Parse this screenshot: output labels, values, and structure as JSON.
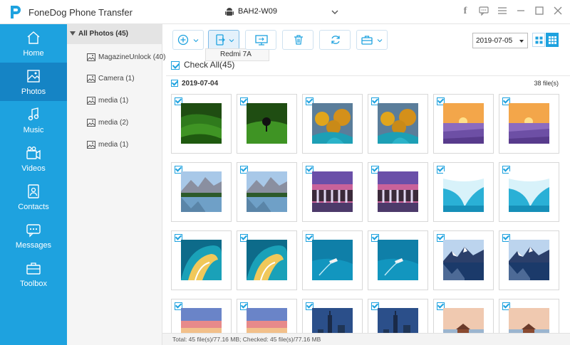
{
  "app": {
    "title": "FoneDog Phone Transfer",
    "device": "BAH2-W09",
    "accent": "#1ea2df"
  },
  "window_controls": [
    "facebook-icon",
    "feedback-icon",
    "menu-icon",
    "minimize-icon",
    "maximize-icon",
    "close-icon"
  ],
  "nav": [
    {
      "label": "Home",
      "icon": "home-icon"
    },
    {
      "label": "Photos",
      "icon": "photos-icon",
      "active": true
    },
    {
      "label": "Music",
      "icon": "music-icon"
    },
    {
      "label": "Videos",
      "icon": "videos-icon"
    },
    {
      "label": "Contacts",
      "icon": "contacts-icon"
    },
    {
      "label": "Messages",
      "icon": "messages-icon"
    },
    {
      "label": "Toolbox",
      "icon": "toolbox-icon"
    }
  ],
  "tree": {
    "root": "All Photos (45)",
    "items": [
      {
        "label": "MagazineUnlock (40)"
      },
      {
        "label": "Camera (1)"
      },
      {
        "label": "media (1)"
      },
      {
        "label": "media (2)"
      },
      {
        "label": "media (1)"
      }
    ]
  },
  "toolbar": {
    "tooltip": "Redmi 7A",
    "date": "2019-07-05"
  },
  "check_all": "Check All(45)",
  "group": {
    "date": "2019-07-04",
    "count": "38 file(s)"
  },
  "photos": [
    {
      "theme": "green-waves"
    },
    {
      "theme": "green-tree"
    },
    {
      "theme": "autumn-river"
    },
    {
      "theme": "autumn-river"
    },
    {
      "theme": "lavender-sunset"
    },
    {
      "theme": "lavender-sunset"
    },
    {
      "theme": "mountain-lake"
    },
    {
      "theme": "mountain-lake"
    },
    {
      "theme": "waterfall-dusk"
    },
    {
      "theme": "waterfall-dusk"
    },
    {
      "theme": "ice-cave"
    },
    {
      "theme": "ice-cave"
    },
    {
      "theme": "ocean-wave"
    },
    {
      "theme": "ocean-wave"
    },
    {
      "theme": "boat-sea"
    },
    {
      "theme": "boat-sea"
    },
    {
      "theme": "snow-mountain"
    },
    {
      "theme": "snow-mountain"
    },
    {
      "theme": "pink-sky"
    },
    {
      "theme": "pink-sky"
    },
    {
      "theme": "city-night"
    },
    {
      "theme": "city-night"
    },
    {
      "theme": "pier-hut"
    },
    {
      "theme": "pier-hut"
    }
  ],
  "status": "Total: 45 file(s)/77.16 MB; Checked: 45 file(s)/77.16 MB"
}
